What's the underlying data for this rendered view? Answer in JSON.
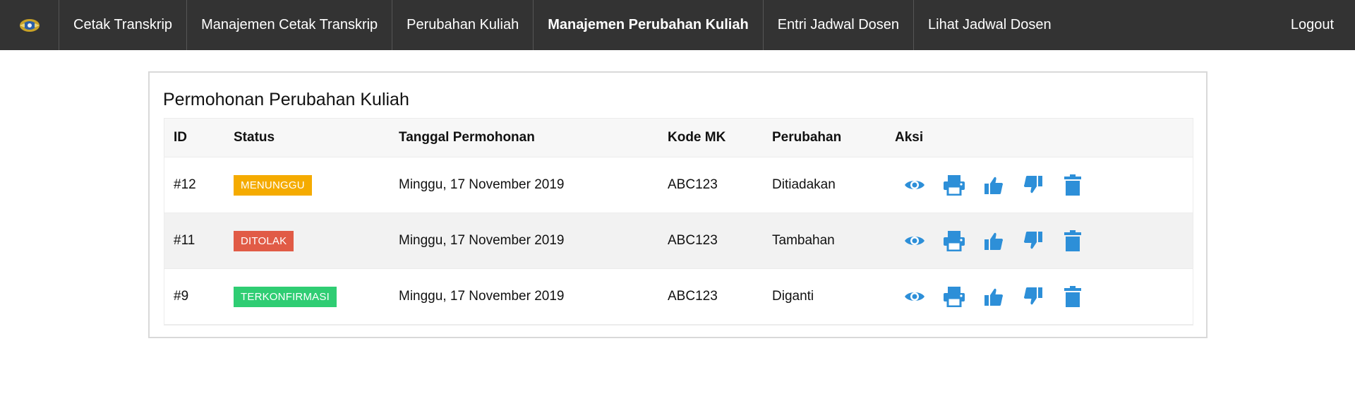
{
  "colors": {
    "topbar": "#333333",
    "action_blue": "#2d8fd8",
    "badge_waiting": "#f5ab00",
    "badge_rejected": "#e15b46",
    "badge_confirmed": "#2fcd73"
  },
  "nav": {
    "items": [
      {
        "label": "Cetak Transkrip"
      },
      {
        "label": "Manajemen Cetak Transkrip"
      },
      {
        "label": "Perubahan Kuliah"
      },
      {
        "label": "Manajemen Perubahan Kuliah"
      },
      {
        "label": "Entri Jadwal Dosen"
      },
      {
        "label": "Lihat Jadwal Dosen"
      }
    ],
    "active_index": 3,
    "logout_label": "Logout"
  },
  "panel": {
    "title": "Permohonan Perubahan Kuliah"
  },
  "table": {
    "headers": {
      "id": "ID",
      "status": "Status",
      "date": "Tanggal Permohonan",
      "kode": "Kode MK",
      "perubahan": "Perubahan",
      "aksi": "Aksi"
    },
    "rows": [
      {
        "id": "#12",
        "status": "MENUNGGU",
        "status_color": "#f5ab00",
        "date": "Minggu, 17 November 2019",
        "kode": "ABC123",
        "perubahan": "Ditiadakan"
      },
      {
        "id": "#11",
        "status": "DITOLAK",
        "status_color": "#e15b46",
        "date": "Minggu, 17 November 2019",
        "kode": "ABC123",
        "perubahan": "Tambahan"
      },
      {
        "id": "#9",
        "status": "TERKONFIRMASI",
        "status_color": "#2fcd73",
        "date": "Minggu, 17 November 2019",
        "kode": "ABC123",
        "perubahan": "Diganti"
      }
    ],
    "actions": [
      "eye-icon",
      "printer-icon",
      "thumbs-up-icon",
      "thumbs-down-icon",
      "trash-icon"
    ]
  }
}
